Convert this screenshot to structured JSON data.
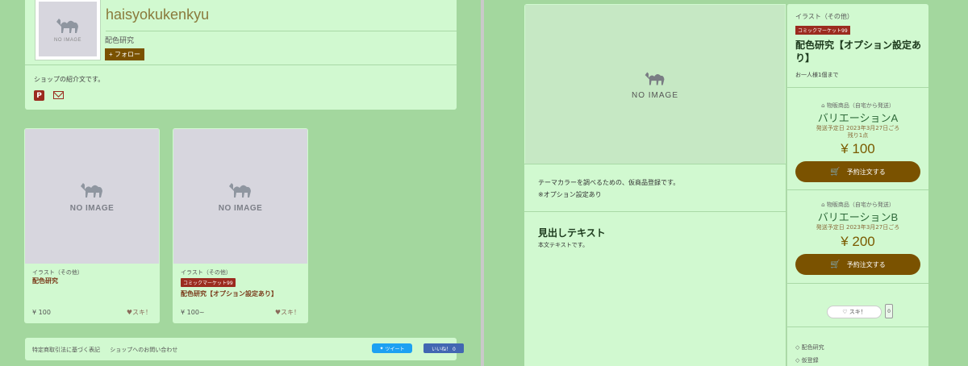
{
  "shop": {
    "name": "haisyokukenkyu",
    "subtitle": "配色研究",
    "follow_label": "+ フォロー",
    "intro": "ショップの紹介文です。",
    "avatar_text": "NO IMAGE",
    "pixiv_icon": "pixiv-icon",
    "mail_icon": "mail-icon"
  },
  "products": [
    {
      "image_text": "NO IMAGE",
      "category": "イラスト（その他）",
      "tag": "",
      "title": "配色研究",
      "price": "¥ 100",
      "suki": "♥スキ！"
    },
    {
      "image_text": "NO IMAGE",
      "category": "イラスト（その他）",
      "tag": "コミックマーケット99",
      "title": "配色研究【オプション設定あり】",
      "price": "¥ 100~",
      "suki": "♥スキ！"
    }
  ],
  "footer": {
    "link1": "特定商取引法に基づく表記",
    "link2": "ショップへのお問い合わせ",
    "tweet": "ツイート",
    "like": "いいね！ 0"
  },
  "detail": {
    "image_text": "NO IMAGE",
    "desc1": "テーマカラーを調べるための、仮商品登録です。",
    "desc2": "※オプション設定あり",
    "heading": "見出しテキスト",
    "body": "本文テキストです。"
  },
  "side": {
    "category": "イラスト（その他）",
    "tag": "コミックマーケット99",
    "title": "配色研究【オプション設定あり】",
    "note": "お一人様1個まで",
    "variations": [
      {
        "type": "物販商品（自宅から発送）",
        "name": "バリエーションA",
        "date": "発送予定日 2023年3月27日ごろ",
        "stock": "残り1点",
        "price": "¥ 100",
        "button": "予約注文する"
      },
      {
        "type": "物販商品（自宅から発送）",
        "name": "バリエーションB",
        "date": "発送予定日 2023年3月27日ごろ",
        "stock": "",
        "price": "¥ 200",
        "button": "予約注文する"
      }
    ],
    "suki_label": "♡ スキ！",
    "suki_count": "0",
    "tags": [
      "配色研究",
      "仮登録"
    ]
  }
}
